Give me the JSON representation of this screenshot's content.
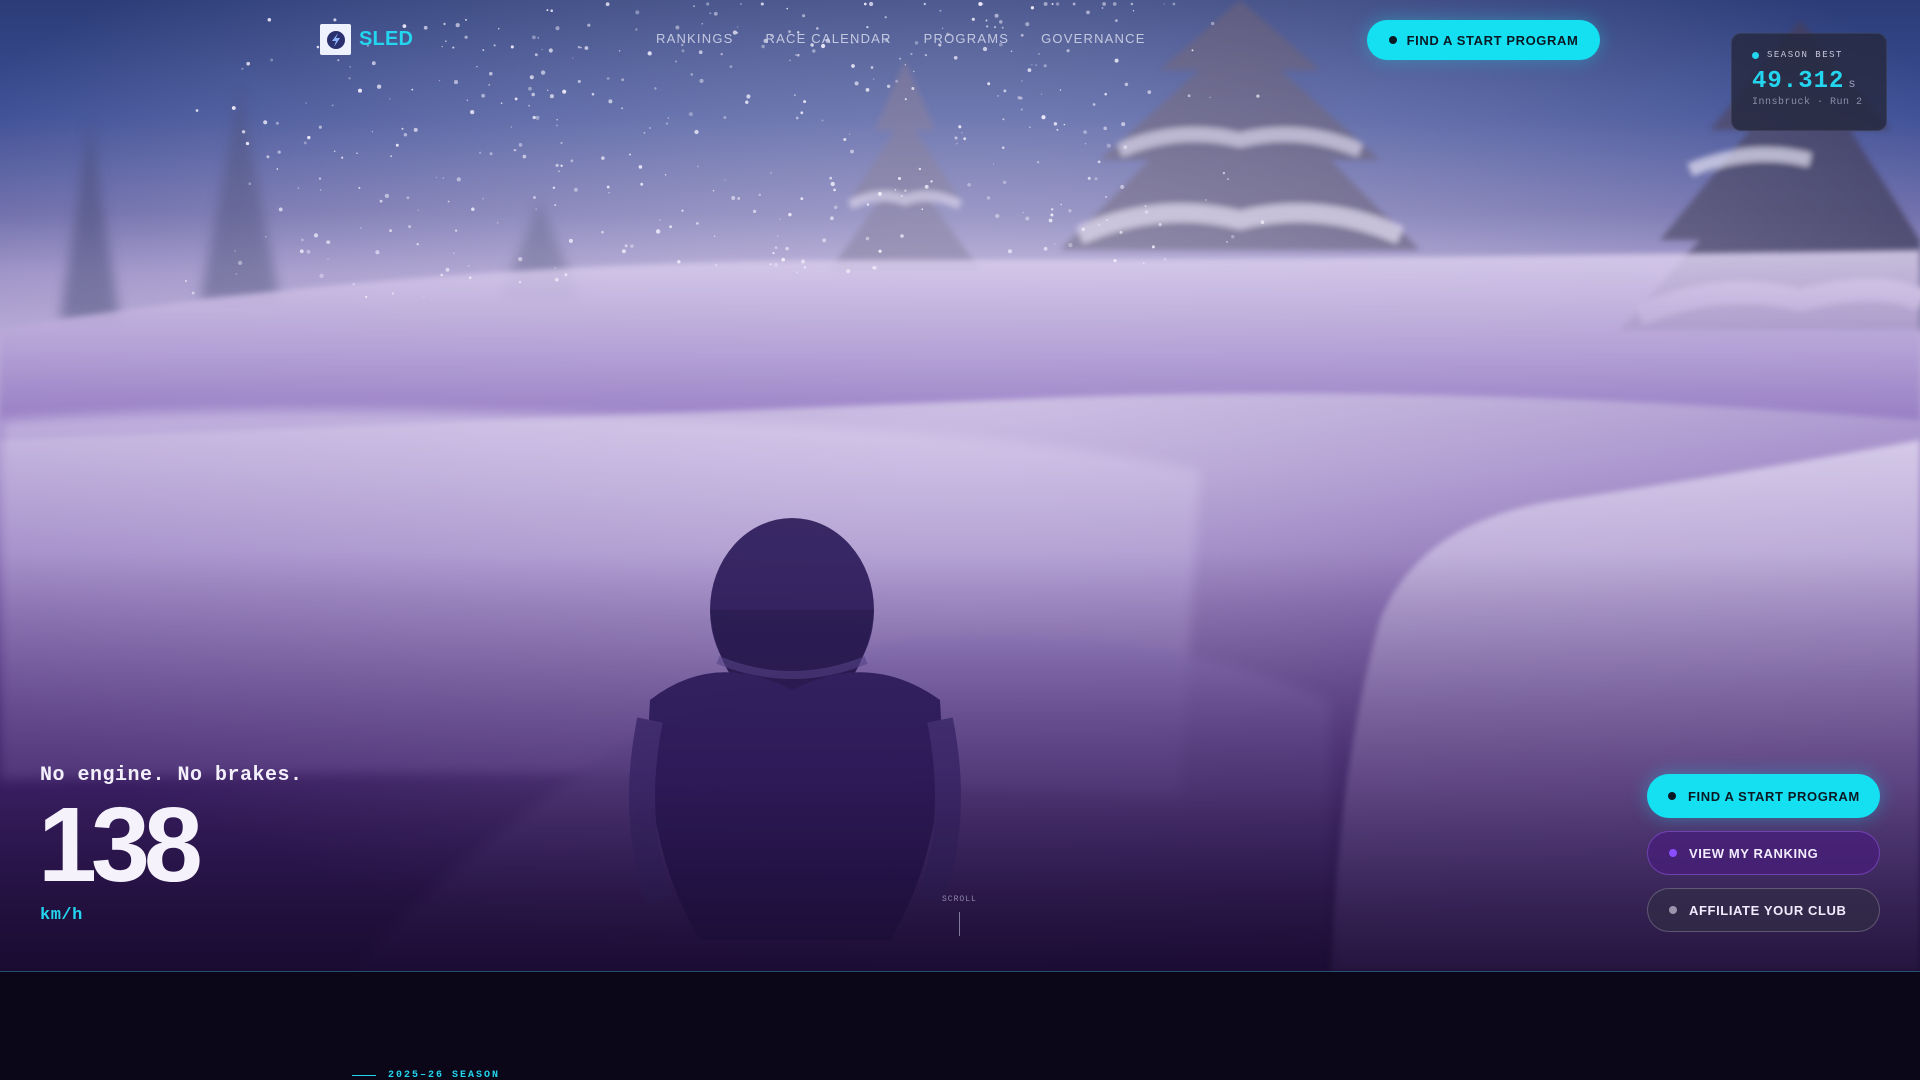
{
  "brand": {
    "name": "SLED",
    "logo_icon": "sled-logo-icon"
  },
  "nav": {
    "items": [
      {
        "label": "RANKINGS"
      },
      {
        "label": "RACE CALENDAR"
      },
      {
        "label": "PROGRAMS"
      },
      {
        "label": "GOVERNANCE"
      }
    ],
    "cta_label": "FIND A START PROGRAM"
  },
  "season_best": {
    "label": "SEASON BEST",
    "time": "49.312",
    "unit": "s",
    "location": "Innsbruck · Run 2"
  },
  "hero": {
    "tagline": "No engine. No brakes.",
    "speed": "138",
    "speed_unit": "km/h",
    "scroll_label": "SCROLL"
  },
  "actions": [
    {
      "label": "FIND A START PROGRAM"
    },
    {
      "label": "VIEW MY RANKING"
    },
    {
      "label": "AFFILIATE YOUR CLUB"
    }
  ],
  "next_section": {
    "eyebrow": "2025–26 SEASON"
  },
  "colors": {
    "accent": "#14e0f2",
    "violet": "#8a4dff",
    "background": "#0b0618"
  }
}
